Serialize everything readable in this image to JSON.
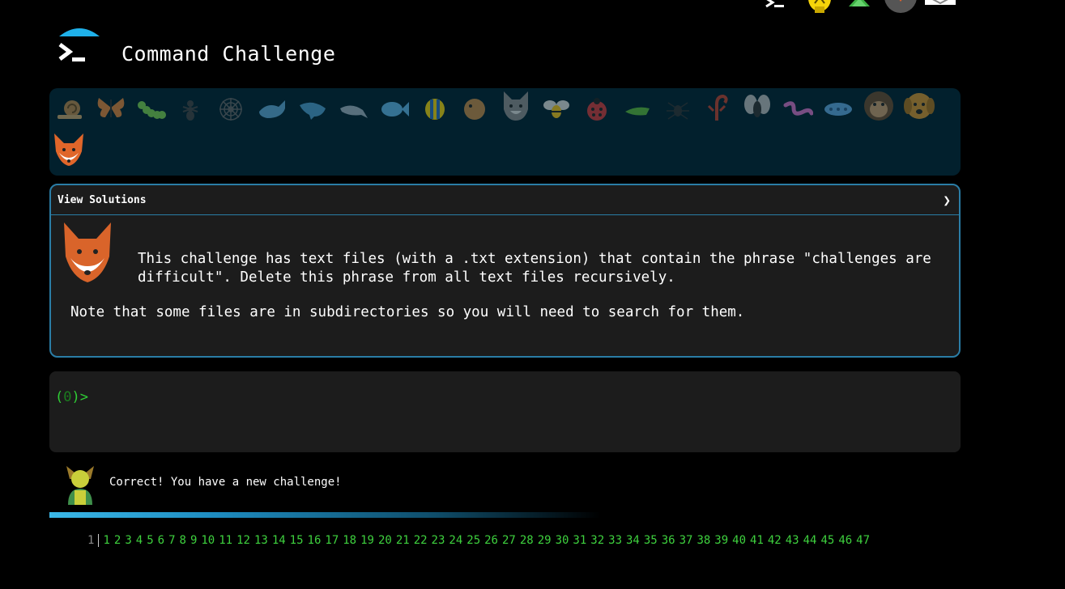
{
  "header": {
    "title": "Command Challenge"
  },
  "top_icons": [
    "terminal-icon",
    "lightbulb-icon",
    "tree-icon",
    "avatar-icon",
    "mail-icon"
  ],
  "animals": [
    "snail",
    "butterfly",
    "caterpillar",
    "ant",
    "spider-web",
    "whale",
    "dolphin",
    "dolphin-2",
    "fish",
    "tropical-fish",
    "blowfish",
    "wolf",
    "bee",
    "ladybug",
    "cricket",
    "spider",
    "scorpion",
    "fly",
    "worm",
    "microbe",
    "monkey",
    "dog",
    "fox"
  ],
  "solutions": {
    "header": "View Solutions",
    "description": "This challenge has text files (with a .txt extension) that contain the phrase \"challenges are difficult\". Delete this phrase from all text files recursively.",
    "note": "Note that some files are in subdirectories so you will need to search for them."
  },
  "terminal": {
    "prompt_open": "(",
    "prompt_num": "0",
    "prompt_close": ")>"
  },
  "message": {
    "text": "Correct! You have a new challenge!"
  },
  "progress": {
    "fraction": 0.6
  },
  "pagination": {
    "current": "1",
    "pages": [
      "1",
      "2",
      "3",
      "4",
      "5",
      "6",
      "7",
      "8",
      "9",
      "10",
      "11",
      "12",
      "13",
      "14",
      "15",
      "16",
      "17",
      "18",
      "19",
      "20",
      "21",
      "22",
      "23",
      "24",
      "25",
      "26",
      "27",
      "28",
      "29",
      "30",
      "31",
      "32",
      "33",
      "34",
      "35",
      "36",
      "37",
      "38",
      "39",
      "40",
      "41",
      "42",
      "43",
      "44",
      "45",
      "46",
      "47"
    ]
  },
  "colors": {
    "accent": "#2a7da6",
    "prompt": "#2fce35",
    "page_link": "#3ed13e",
    "bar_bg": "#02202d"
  }
}
